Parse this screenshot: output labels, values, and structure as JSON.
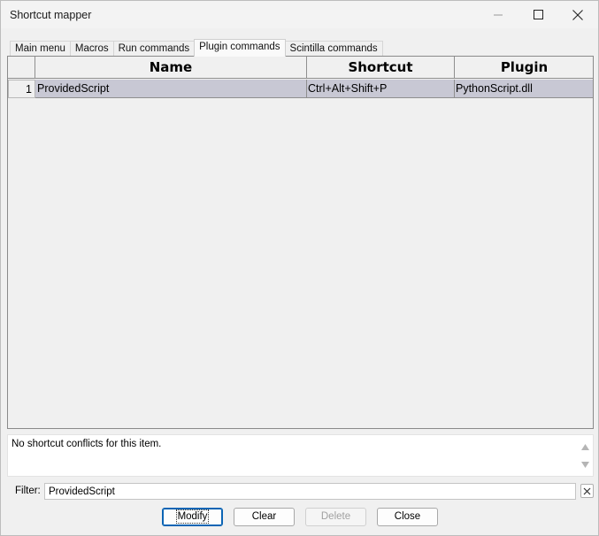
{
  "window": {
    "title": "Shortcut mapper"
  },
  "tabs": [
    {
      "label": "Main menu",
      "active": false
    },
    {
      "label": "Macros",
      "active": false
    },
    {
      "label": "Run commands",
      "active": false
    },
    {
      "label": "Plugin commands",
      "active": true
    },
    {
      "label": "Scintilla commands",
      "active": false
    }
  ],
  "grid": {
    "columns": [
      "Name",
      "Shortcut",
      "Plugin"
    ],
    "rows": [
      {
        "index": "1",
        "name": "ProvidedScript",
        "shortcut": "Ctrl+Alt+Shift+P",
        "plugin": "PythonScript.dll",
        "selected": true
      }
    ],
    "selection_color": "#c8c8d4"
  },
  "conflict": {
    "text": "No shortcut conflicts for this item."
  },
  "filter": {
    "label": "Filter:",
    "value": "ProvidedScript"
  },
  "buttons": {
    "modify": "Modify",
    "clear": "Clear",
    "delete": "Delete",
    "close": "Close"
  },
  "icons": {
    "minimize": "minimize-icon",
    "maximize": "maximize-icon",
    "close": "close-icon",
    "scroll_up": "scroll-up-icon",
    "scroll_down": "scroll-down-icon",
    "clear_filter": "clear-filter-icon"
  }
}
